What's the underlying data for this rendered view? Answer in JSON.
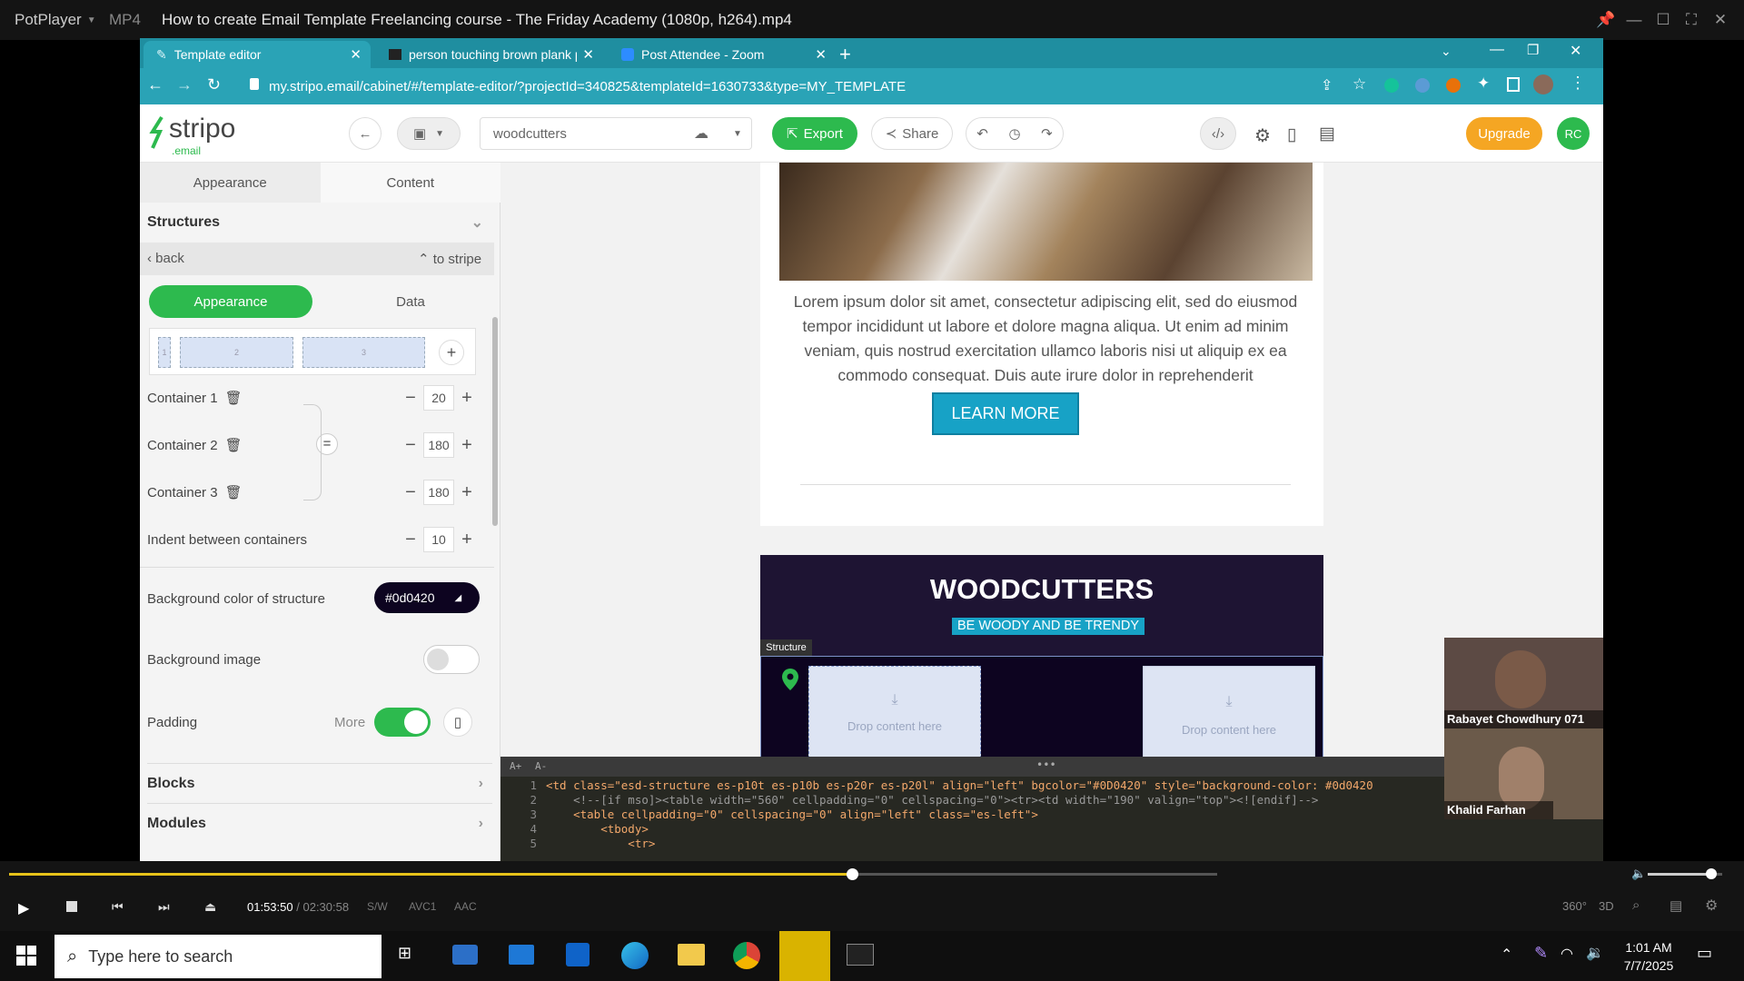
{
  "player": {
    "app_name": "PotPlayer",
    "format": "MP4",
    "title": "How to create Email Template  Freelancing course - The Friday Academy (1080p, h264).mp4",
    "time_current": "01:53:50",
    "time_separator": "/",
    "time_total": "02:30:58",
    "tag_sw": "S/W",
    "tag_video": "AVC1",
    "tag_audio": "AAC",
    "progress": 0.698,
    "volume": 0.85,
    "right_labels": [
      "360°",
      "3D"
    ]
  },
  "browser": {
    "tabs": [
      {
        "label": "Template editor",
        "active": true
      },
      {
        "label": "person touching brown plank ph",
        "active": false
      },
      {
        "label": "Post Attendee - Zoom",
        "active": false
      }
    ],
    "url": "my.stripo.email/cabinet/#/template-editor/?projectId=340825&templateId=1630733&type=MY_TEMPLATE"
  },
  "stripo": {
    "logo_main": "stripo",
    "logo_sub": ".email",
    "template_name": "woodcutters",
    "export_label": "Export",
    "share_label": "Share",
    "upgrade_label": "Upgrade",
    "avatar_initials": "RC",
    "panel_tabs": [
      "Appearance",
      "Content"
    ],
    "structures_label": "Structures",
    "back_label": "back",
    "to_stripe_label": "to stripe",
    "sub_tabs": [
      "Appearance",
      "Data"
    ],
    "column_labels": [
      "1",
      "2",
      "3"
    ],
    "containers": [
      {
        "label": "Container 1",
        "value": "20"
      },
      {
        "label": "Container 2",
        "value": "180"
      },
      {
        "label": "Container 3",
        "value": "180"
      }
    ],
    "indent_label": "Indent between containers",
    "indent_value": "10",
    "bg_color_label": "Background color of structure",
    "bg_color_value": "#0d0420",
    "bg_image_label": "Background image",
    "padding_label": "Padding",
    "more_label": "More",
    "blocks_label": "Blocks",
    "modules_label": "Modules"
  },
  "email": {
    "body_text": "Lorem ipsum dolor sit amet, consectetur adipiscing elit, sed do eiusmod tempor incididunt ut labore et dolore magna aliqua. Ut enim ad minim veniam, quis nostrud exercitation ullamco laboris nisi ut aliquip ex ea commodo consequat. Duis aute irure dolor in reprehenderit",
    "button_label": "LEARN MORE",
    "banner_title": "WOODCUTTERS",
    "banner_tagline": "BE WOODY AND BE TRENDY",
    "structure_tag": "Structure",
    "drop_label": "Drop content here"
  },
  "code_editor": {
    "font_buttons": [
      "A+",
      "A-"
    ],
    "lines": [
      {
        "n": "1",
        "text": "<td class=\"esd-structure es-p10t es-p10b es-p20r es-p20l\" align=\"left\" bgcolor=\"#0D0420\" style=\"background-color: #0d0420"
      },
      {
        "n": "2",
        "text": "    <!--[if mso]><table width=\"560\" cellpadding=\"0\" cellspacing=\"0\"><tr><td width=\"190\" valign=\"top\"><![endif]-->"
      },
      {
        "n": "3",
        "text": "    <table cellpadding=\"0\" cellspacing=\"0\" align=\"left\" class=\"es-left\">"
      },
      {
        "n": "4",
        "text": "        <tbody>"
      },
      {
        "n": "5",
        "text": "            <tr>"
      }
    ]
  },
  "zoom": {
    "participants": [
      "Rabayet Chowdhury 071",
      "Khalid Farhan"
    ]
  },
  "taskbar": {
    "search_placeholder": "Type here to search",
    "time": "1:01 AM",
    "date": "7/7/2025"
  },
  "colors": {
    "teal": "#2aa3b6",
    "stripo_green": "#2dba4e",
    "upgrade": "#f5a623",
    "learn_more": "#17a2c6",
    "banner": "#1e1433",
    "structure_bg": "#0d0420"
  }
}
